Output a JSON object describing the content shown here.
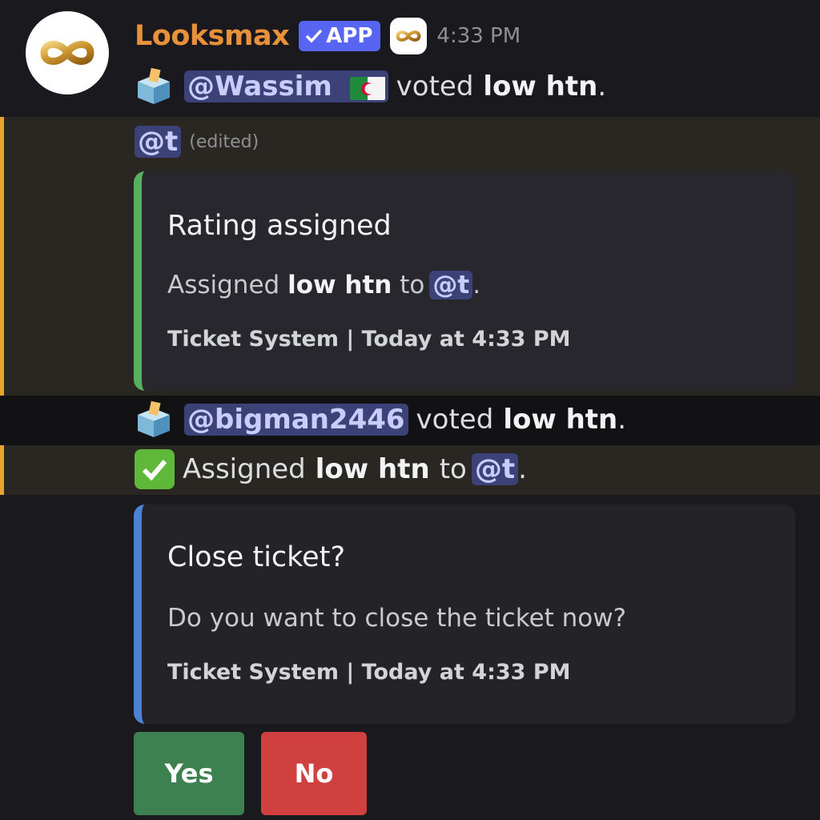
{
  "message": {
    "author": "Looksmax",
    "app_badge": "APP",
    "timestamp": "4:33 PM",
    "avatar_icon": "infinity-logo-icon"
  },
  "vote1": {
    "icon": "ballot-box-icon",
    "mention": "@Wassim",
    "flag": "algeria-flag-icon",
    "verb": "voted",
    "rating": "low htn",
    "punct": "."
  },
  "mention_line": {
    "mention": "@t",
    "edited": "(edited)"
  },
  "embed1": {
    "title": "Rating assigned",
    "desc_prefix": "Assigned",
    "desc_rating": "low htn",
    "desc_to": "to",
    "desc_mention": "@t",
    "desc_punct": ".",
    "footer": "Ticket System | Today at 4:33 PM",
    "accent": "#57b05d"
  },
  "vote2": {
    "icon": "ballot-box-icon",
    "mention": "@bigman2446",
    "verb": "voted",
    "rating": "low htn",
    "punct": "."
  },
  "assigned_line": {
    "icon": "check-mark-button-icon",
    "prefix": "Assigned",
    "rating": "low htn",
    "to": "to",
    "mention": "@t",
    "punct": "."
  },
  "embed2": {
    "title": "Close ticket?",
    "desc": "Do you want to close the ticket now?",
    "footer": "Ticket System | Today at 4:33 PM",
    "accent": "#4c82d6"
  },
  "buttons": {
    "yes": "Yes",
    "no": "No"
  },
  "colors": {
    "background": "#1a1a1e",
    "username": "#e8913a",
    "highlight_bar": "#e6a52d",
    "mention_bg": "#3c4277",
    "yes_button": "#3d8150",
    "no_button": "#d0403f"
  }
}
